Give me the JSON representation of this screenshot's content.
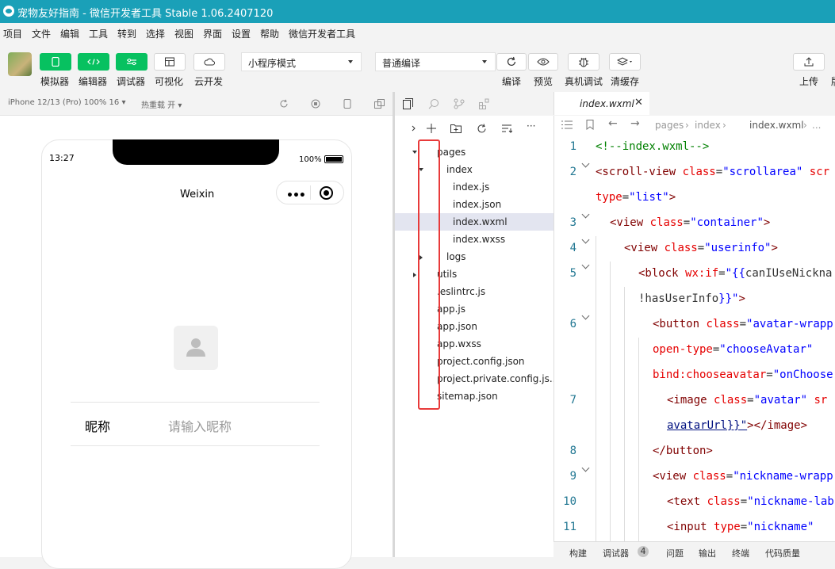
{
  "window": {
    "title": "宠物友好指南 - 微信开发者工具 Stable 1.06.2407120"
  },
  "menu": [
    "项目",
    "文件",
    "编辑",
    "工具",
    "转到",
    "选择",
    "视图",
    "界面",
    "设置",
    "帮助",
    "微信开发者工具"
  ],
  "toolbar": {
    "buttons": [
      "模拟器",
      "编辑器",
      "调试器",
      "可视化",
      "云开发"
    ],
    "mode_select": "小程序模式",
    "compile_select": "普通编译",
    "actions": [
      "编译",
      "预览",
      "真机调试",
      "清缓存"
    ],
    "right_actions": [
      "上传",
      "版"
    ]
  },
  "simulator": {
    "device": "iPhone 12/13 (Pro) 100% 16 ▾",
    "hotreload": "热重载 开 ▾",
    "time": "13:27",
    "battery": "100%",
    "nav_title": "Weixin",
    "nickname_label": "昵称",
    "nickname_placeholder": "请输入昵称"
  },
  "filetree": [
    {
      "name": "pages",
      "depth": 0,
      "expanded": true
    },
    {
      "name": "index",
      "depth": 1,
      "expanded": true
    },
    {
      "name": "index.js",
      "depth": 2
    },
    {
      "name": "index.json",
      "depth": 2
    },
    {
      "name": "index.wxml",
      "depth": 2,
      "selected": true
    },
    {
      "name": "index.wxss",
      "depth": 2
    },
    {
      "name": "logs",
      "depth": 1,
      "expanded": false
    },
    {
      "name": "utils",
      "depth": 0,
      "expanded": false
    },
    {
      "name": ".eslintrc.js",
      "depth": 0
    },
    {
      "name": "app.js",
      "depth": 0
    },
    {
      "name": "app.json",
      "depth": 0
    },
    {
      "name": "app.wxss",
      "depth": 0
    },
    {
      "name": "project.config.json",
      "depth": 0
    },
    {
      "name": "project.private.config.js...",
      "depth": 0
    },
    {
      "name": "sitemap.json",
      "depth": 0
    }
  ],
  "editor": {
    "tab": "index.wxml",
    "breadcrumb": [
      "pages",
      "index",
      "index.wxml",
      "..."
    ],
    "line_numbers": [
      "1",
      "2",
      "3",
      "4",
      "5",
      "6",
      "7",
      "8",
      "9",
      "10",
      "11"
    ]
  },
  "bottom_tabs": {
    "items": [
      "构建",
      "调试器",
      "问题",
      "输出",
      "终端",
      "代码质量"
    ],
    "debugger_badge": "4"
  },
  "colors": {
    "titlebar": "#1aa0b8",
    "green": "#07c160",
    "highlight": "#e83a3a"
  }
}
